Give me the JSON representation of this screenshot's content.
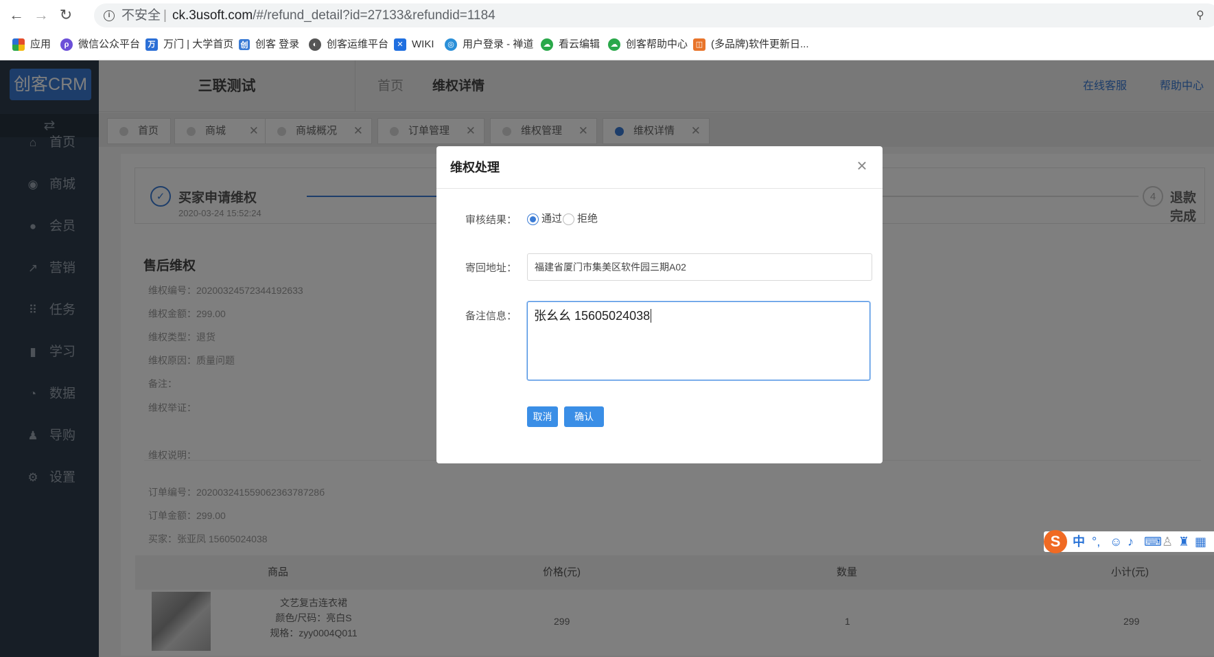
{
  "browser": {
    "insecure_label": "不安全",
    "url_host": "ck.3usoft.com",
    "url_path": "/#/refund_detail?id=27133&refundid=1184",
    "bookmarks": [
      {
        "label": "应用",
        "icon": "apps-grid-icon",
        "color": "#e44c2b"
      },
      {
        "label": "微信公众平台",
        "icon": "wechat-mp-icon",
        "color": "#6b4fd8"
      },
      {
        "label": "万门 | 大学首页",
        "icon": "wanmen-icon",
        "color": "#2b6fd6"
      },
      {
        "label": "创客 登录",
        "icon": "chuangke-icon",
        "color": "#3a7bd5"
      },
      {
        "label": "创客运维平台",
        "icon": "globe-icon",
        "color": "#555555"
      },
      {
        "label": "WIKI",
        "icon": "confluence-icon",
        "color": "#1f6fe0"
      },
      {
        "label": "用户登录 - 禅道",
        "icon": "zentao-icon",
        "color": "#2a8fd8"
      },
      {
        "label": "看云编辑",
        "icon": "kancloud-icon",
        "color": "#2aa84a"
      },
      {
        "label": "创客帮助中心",
        "icon": "kancloud-icon",
        "color": "#2aa84a"
      },
      {
        "label": "(多品牌)软件更新日...",
        "icon": "update-log-icon",
        "color": "#e8742a"
      }
    ]
  },
  "sidebar": {
    "logo": "创客CRM",
    "items": [
      {
        "label": "首页",
        "icon": "home-icon",
        "glyph": "⌂"
      },
      {
        "label": "商城",
        "icon": "mall-icon",
        "glyph": "◉"
      },
      {
        "label": "会员",
        "icon": "member-icon",
        "glyph": "●"
      },
      {
        "label": "营销",
        "icon": "trend-icon",
        "glyph": "↗"
      },
      {
        "label": "任务",
        "icon": "task-grid-icon",
        "glyph": "⠿"
      },
      {
        "label": "学习",
        "icon": "book-icon",
        "glyph": "▮"
      },
      {
        "label": "数据",
        "icon": "pie-icon",
        "glyph": "◔"
      },
      {
        "label": "导购",
        "icon": "guide-icon",
        "glyph": "♟"
      },
      {
        "label": "设置",
        "icon": "settings-icon",
        "glyph": "⚙"
      }
    ]
  },
  "topbar": {
    "store_name": "三联测试",
    "crumb_home": "首页",
    "crumb_current": "维权详情",
    "online_service": "在线客服",
    "help_center": "帮助中心"
  },
  "tabs": [
    {
      "label": "首页",
      "closable": false,
      "active": false
    },
    {
      "label": "商城",
      "closable": true,
      "active": false
    },
    {
      "label": "商城概况",
      "closable": true,
      "active": false
    },
    {
      "label": "订单管理",
      "closable": true,
      "active": false
    },
    {
      "label": "维权管理",
      "closable": true,
      "active": false
    },
    {
      "label": "维权详情",
      "closable": true,
      "active": true
    }
  ],
  "steps": {
    "step1_title": "买家申请维权",
    "step1_time": "2020-03-24 15:52:24",
    "step4_num": "4",
    "step4_title": "退款完成"
  },
  "detail": {
    "section_title": "售后维权",
    "rows": [
      "维权编号：20200324572344192633",
      "维权金额：299.00",
      "维权类型：退货",
      "维权原因：质量问题",
      "备注：",
      "维权举证：",
      "维权说明：",
      "订单编号：20200324155906236378728б",
      "订单金额：299.00",
      "买家：张亚凤  15605024038"
    ]
  },
  "table": {
    "headers": [
      "商品",
      "价格(元)",
      "数量",
      "小计(元)"
    ],
    "rows": [
      {
        "name": "文艺复古连衣裙",
        "spec": "颜色/尺码：亮白S",
        "sku": "规格：zyy0004Q011",
        "price": "299",
        "qty": "1",
        "subtotal": "299"
      }
    ]
  },
  "modal": {
    "title": "维权处理",
    "result_label": "审核结果：",
    "option_pass": "通过",
    "option_reject": "拒绝",
    "selected": "通过",
    "address_label": "寄回地址：",
    "address_value": "福建省厦门市集美区软件园三期A02",
    "remark_label": "备注信息：",
    "remark_value": "张幺幺  15605024038",
    "cancel_label": "取消",
    "confirm_label": "确认"
  },
  "ime": {
    "brand": "S",
    "lang": "中",
    "punct": "°,"
  }
}
